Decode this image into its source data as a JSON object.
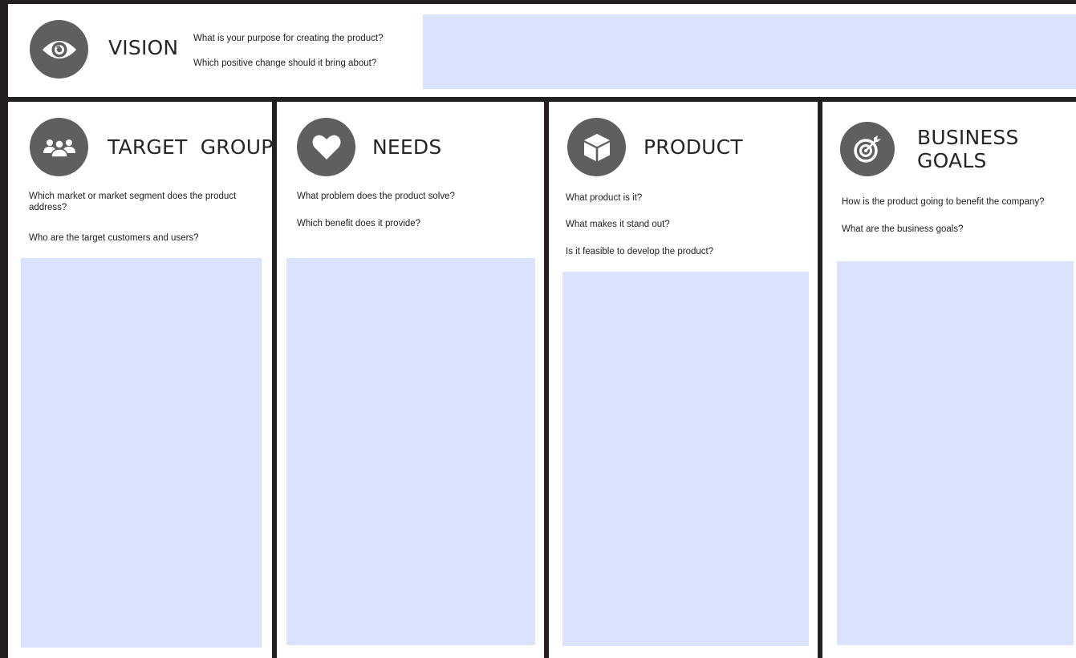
{
  "colors": {
    "frame": "#231f20",
    "icon_bg": "#5f5f5f",
    "answer_area": "#dbe2fb"
  },
  "vision": {
    "icon": "eye-icon",
    "title": "VISION",
    "questions": [
      "What is your purpose for creating the product?",
      "Which positive change should it bring about?"
    ]
  },
  "sections": [
    {
      "icon": "users-icon",
      "title": "TARGET  GROUP",
      "questions": [
        "Which market or market segment does the product address?",
        "Who are the target customers and users?"
      ]
    },
    {
      "icon": "heart-icon",
      "title": "NEEDS",
      "questions": [
        "What problem does the product solve?",
        "Which benefit does it provide?"
      ]
    },
    {
      "icon": "cube-icon",
      "title": "PRODUCT",
      "questions": [
        "What product is it?",
        "What makes it stand out?",
        "Is it feasible to develop the product?"
      ]
    },
    {
      "icon": "target-icon",
      "title": "BUSINESS GOALS",
      "questions": [
        "How is the product going to benefit the company?",
        "What are the business goals?"
      ]
    }
  ]
}
